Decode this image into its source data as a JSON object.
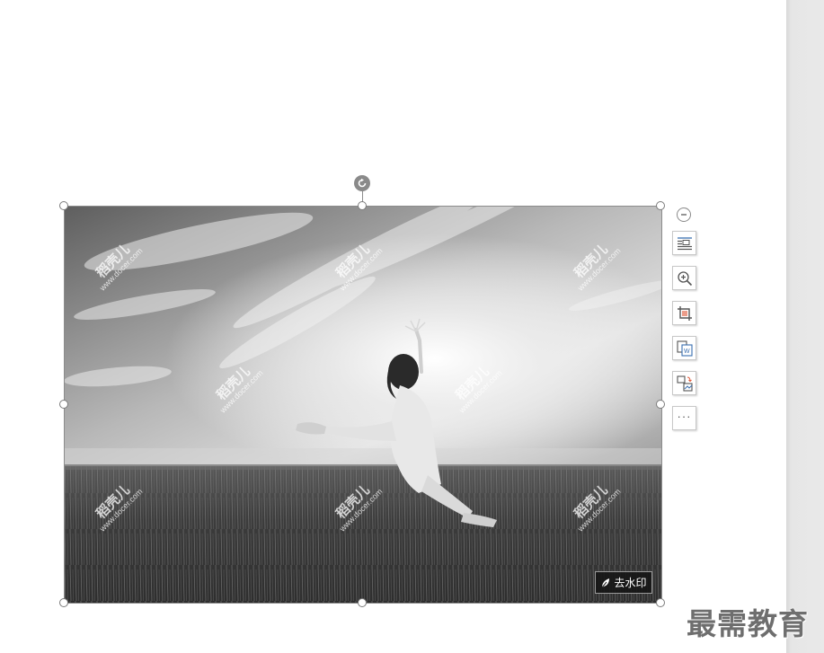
{
  "watermark": {
    "text": "稻壳儿",
    "url": "www.docer.com"
  },
  "remove_watermark_label": "去水印",
  "brand_text": "最需教育",
  "toolbar": {
    "items": [
      {
        "name": "text-wrap",
        "icon": "text-wrap-icon"
      },
      {
        "name": "zoom-preview",
        "icon": "zoom-in-icon"
      },
      {
        "name": "crop",
        "icon": "crop-icon"
      },
      {
        "name": "image-to-text",
        "icon": "image-to-text-icon"
      },
      {
        "name": "replace-image",
        "icon": "replace-image-icon"
      },
      {
        "name": "more",
        "icon": "more-icon"
      }
    ],
    "more_label": "···"
  },
  "colors": {
    "handle_stroke": "#7b7b7b",
    "rotate_handle": "#8a8a8a",
    "scroll_track": "#e6e6e6"
  }
}
